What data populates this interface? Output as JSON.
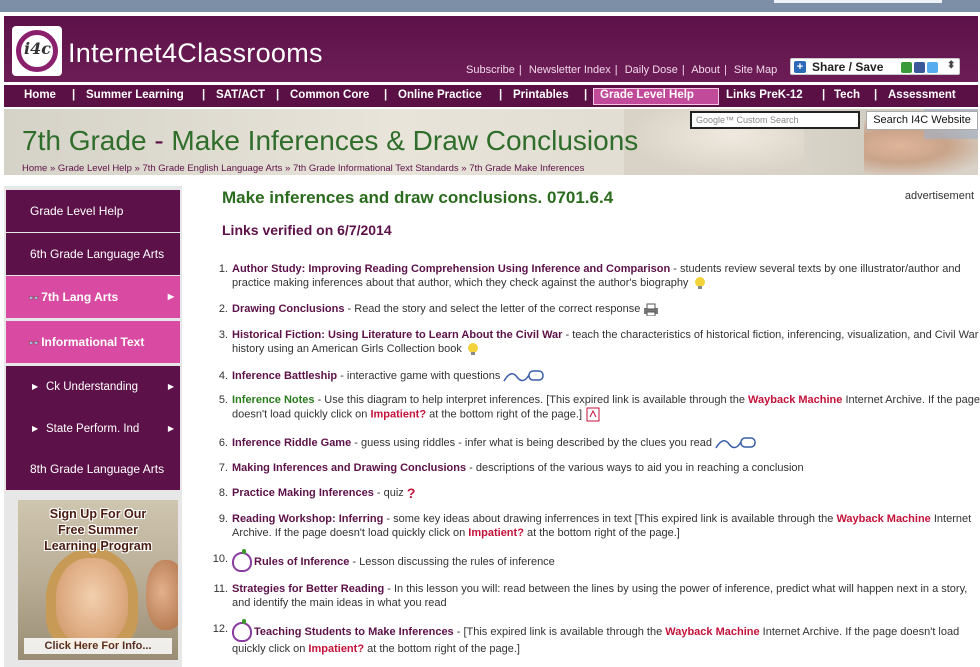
{
  "brand": {
    "logo_text": "i4c",
    "name": "Internet4Classrooms"
  },
  "top_links": [
    "Subscribe",
    "Newsletter Index",
    "Daily Dose",
    "About",
    "Site Map"
  ],
  "share": {
    "label": "Share / Save"
  },
  "nav": {
    "items": [
      "Home",
      "Summer Learning",
      "SAT/ACT",
      "Common Core",
      "Online Practice",
      "Printables",
      "Grade Level Help",
      "Links PreK-12",
      "Tech",
      "Assessment"
    ],
    "active": "Grade Level Help"
  },
  "banner": {
    "title_grade": "7th Grade",
    "title_dash": "-",
    "title_topic": "Make Inferences & Draw Conclusions",
    "breadcrumbs": [
      "Home",
      "Grade Level Help",
      "7th Grade English Language Arts",
      "7th Grade Informational Text Standards",
      "7th Grade Make Inferences"
    ],
    "crumb_sep": "»",
    "search_placeholder": "Google™ Custom Search",
    "search_button": "Search I4C Website"
  },
  "sidebar": {
    "items": [
      "Grade Level Help",
      "6th Grade Language Arts",
      "7th Lang Arts",
      "Informational Text",
      "Ck Understanding",
      "State Perform. Ind",
      "8th Grade Language Arts"
    ],
    "promo_line1": "Sign Up For Our",
    "promo_line2": "Free Summer",
    "promo_line3": "Learning Program",
    "promo_cta": "Click Here For Info..."
  },
  "main": {
    "heading": "Make inferences and draw conclusions. 0701.6.4",
    "verified": "Links verified on 6/7/2014",
    "ad_label": "advertisement",
    "wayback": "Wayback Machine",
    "impatient": "Impatient?",
    "links": [
      {
        "num": "1.",
        "title": "Author Study: Improving Reading Comprehension Using Inference and Comparison",
        "desc": " - students review several texts by one illustrator/author and practice making inferences about that author, which they check against the author's biography"
      },
      {
        "num": "2.",
        "title": "Drawing Conclusions",
        "desc": " - Read the story and select the letter of the correct response"
      },
      {
        "num": "3.",
        "title": "Historical Fiction: Using Literature to Learn About the Civil War",
        "desc": " - teach the characteristics of historical fiction, inferencing, visualization, and Civil War history using an American Girls Collection book"
      },
      {
        "num": "4.",
        "title": "Inference Battleship",
        "desc": " - interactive game with questions"
      },
      {
        "num": "5.",
        "title": "Inference Notes",
        "desc": " - Use this diagram to help interpret inferences. [This expired link is available through the ",
        "desc2": " Internet Archive. If the page doesn't load quickly click on ",
        "desc3": " at the bottom right of the page.]"
      },
      {
        "num": "6.",
        "title": "Inference Riddle Game",
        "desc": " - guess using riddles - infer what is being described by the clues you read"
      },
      {
        "num": "7.",
        "title": "Making Inferences and Drawing Conclusions",
        "desc": " - descriptions of the various ways to aid you in reaching a conclusion"
      },
      {
        "num": "8.",
        "title": "Practice Making Inferences",
        "desc": " - quiz"
      },
      {
        "num": "9.",
        "title": "Reading Workshop: Inferring",
        "desc": " - some key ideas about drawing inferrences in text [This expired link is available through the ",
        "desc2": " Internet Archive. If the page doesn't load quickly click on ",
        "desc3": " at the bottom right of the page.]"
      },
      {
        "num": "10.",
        "title": "Rules of Inference",
        "desc": " - Lesson discussing the rules of inference"
      },
      {
        "num": "11.",
        "title": "Strategies for Better Reading",
        "desc": " - In this lesson you will: read between the lines by using the power of inference, predict what will happen next in a story, and identify the main ideas in what you read"
      },
      {
        "num": "12.",
        "title": "Teaching Students to Make Inferences",
        "desc": " - [This expired link is available through the ",
        "desc2": " Internet Archive. If the page doesn't load quickly click on ",
        "desc3": " at the bottom right of the page.]"
      }
    ]
  },
  "colors": {
    "primary": "#5c1148",
    "accent_pink": "#d94aa3",
    "heading_green": "#2a6b1d",
    "wayback_red": "#c4123a"
  }
}
